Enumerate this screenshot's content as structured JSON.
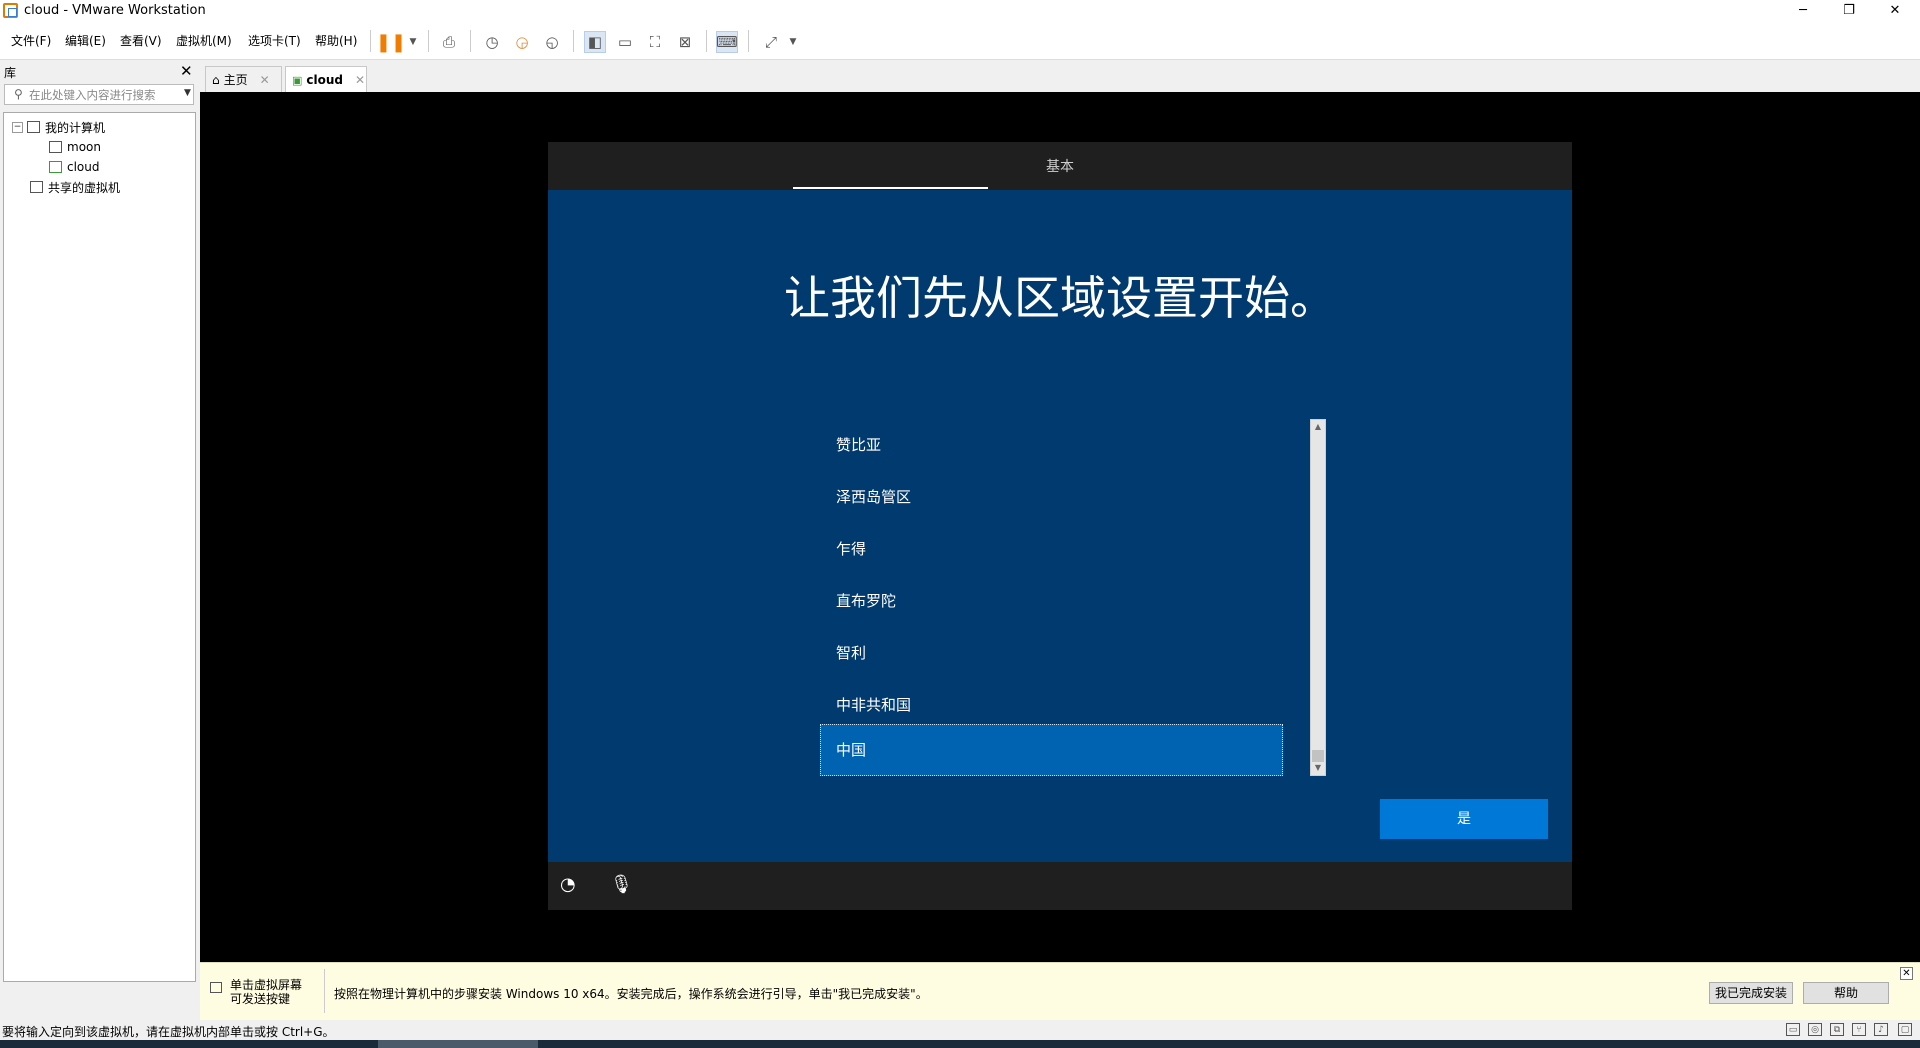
{
  "window": {
    "title": "cloud - VMware Workstation"
  },
  "menu": [
    "文件(F)",
    "编辑(E)",
    "查看(V)",
    "虚拟机(M)",
    "选项卡(T)",
    "帮助(H)"
  ],
  "library": {
    "title": "库",
    "search_placeholder": "在此处键入内容进行搜索",
    "tree": {
      "root": "我的计算机",
      "vms": [
        "moon",
        "cloud"
      ],
      "shared": "共享的虚拟机"
    }
  },
  "tabs": [
    {
      "label": "主页",
      "active": false
    },
    {
      "label": "cloud",
      "active": true
    }
  ],
  "oobe": {
    "step": "基本",
    "heading": "让我们先从区域设置开始。",
    "regions": [
      "赞比亚",
      "泽西岛管区",
      "乍得",
      "直布罗陀",
      "智利",
      "中非共和国",
      "中国"
    ],
    "selected": "中国",
    "yes_button": "是"
  },
  "infobar": {
    "click_hint": "单击虚拟屏幕\n可发送按键",
    "message": "按照在物理计算机中的步骤安装 Windows 10 x64。安装完成后，操作系统会进行引导，单击\"我已完成安装\"。",
    "done_button": "我已完成安装",
    "help_button": "帮助"
  },
  "statusbar": {
    "text": "要将输入定向到该虚拟机，请在虚拟机内部单击或按 Ctrl+G。"
  },
  "colors": {
    "oobe_bg": "#003a6e",
    "accent": "#0078d7",
    "selected": "#0063b1"
  }
}
